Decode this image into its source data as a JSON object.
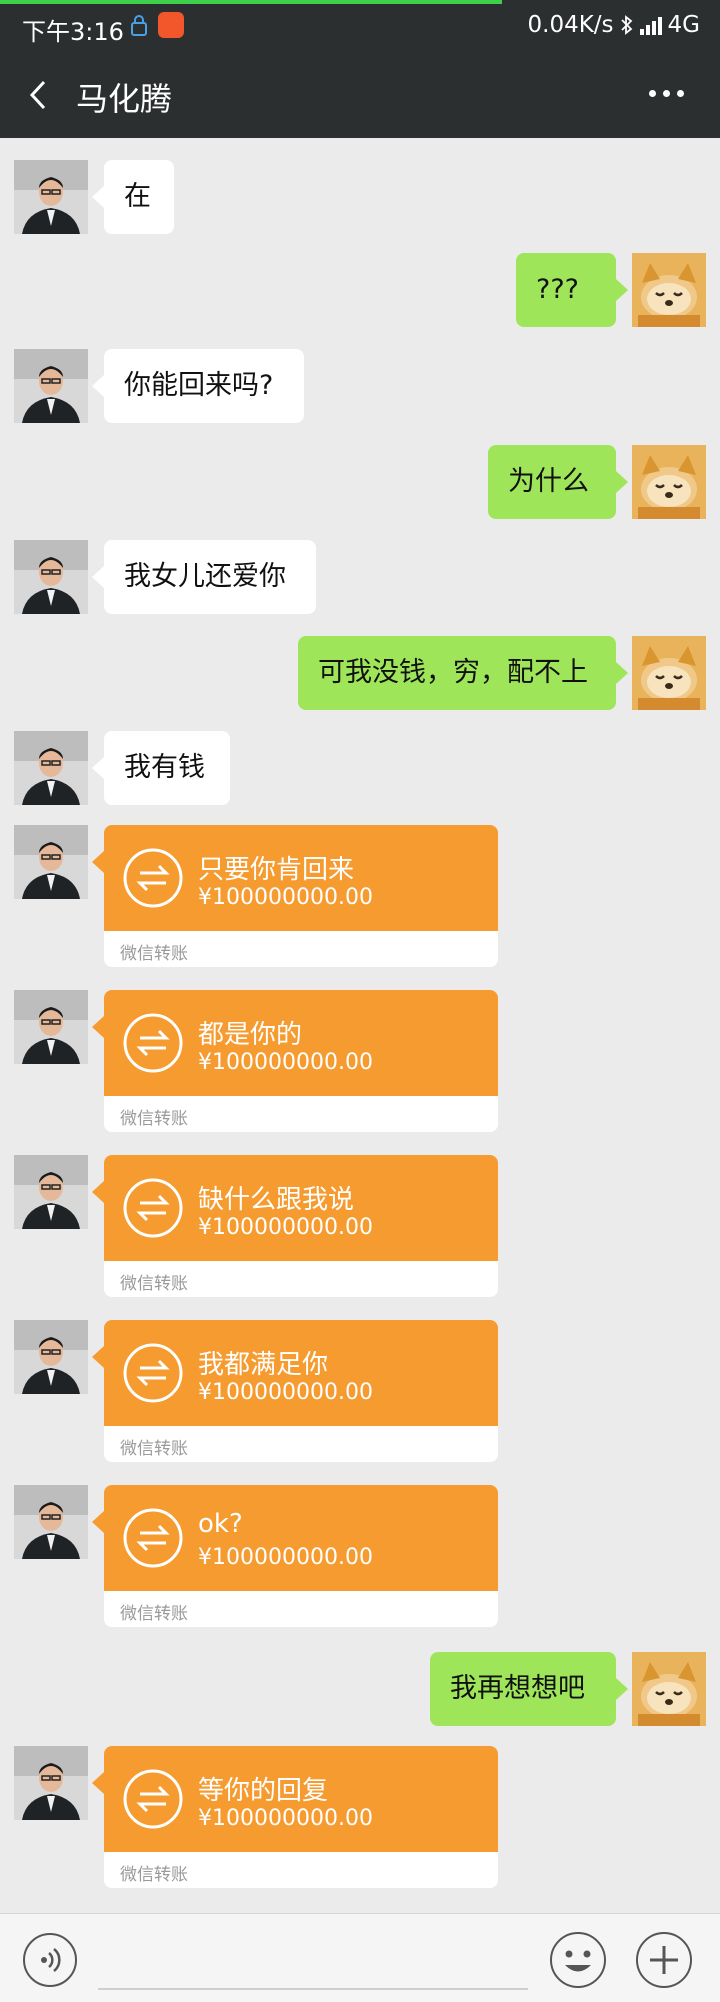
{
  "status_bar": {
    "time": "下午3:16",
    "network_speed": "0.04K/s",
    "network_type": "4G",
    "icons": [
      "lock-icon",
      "app-notification-icon",
      "bluetooth-icon",
      "signal-icon"
    ]
  },
  "header": {
    "title": "马化腾",
    "back_icon": "chevron-left-icon",
    "more_icon": "more-dots-icon",
    "background": "#2b2f30"
  },
  "colors": {
    "sent_bubble": "#9fe55a",
    "received_bubble": "#ffffff",
    "transfer_card": "#f69b30",
    "chat_background": "#ebebeb"
  },
  "messages": [
    {
      "side": "left",
      "type": "text",
      "text": "在"
    },
    {
      "side": "right",
      "type": "text",
      "text": "???"
    },
    {
      "side": "left",
      "type": "text",
      "text": "你能回来吗?"
    },
    {
      "side": "right",
      "type": "text",
      "text": "为什么"
    },
    {
      "side": "left",
      "type": "text",
      "text": "我女儿还爱你"
    },
    {
      "side": "right",
      "type": "text",
      "text": "可我没钱，穷，配不上"
    },
    {
      "side": "left",
      "type": "text",
      "text": "我有钱"
    },
    {
      "side": "left",
      "type": "transfer",
      "note": "只要你肯回来",
      "amount": "¥100000000.00",
      "label": "微信转账"
    },
    {
      "side": "left",
      "type": "transfer",
      "note": "都是你的",
      "amount": "¥100000000.00",
      "label": "微信转账"
    },
    {
      "side": "left",
      "type": "transfer",
      "note": "缺什么跟我说",
      "amount": "¥100000000.00",
      "label": "微信转账"
    },
    {
      "side": "left",
      "type": "transfer",
      "note": "我都满足你",
      "amount": "¥100000000.00",
      "label": "微信转账"
    },
    {
      "side": "left",
      "type": "transfer",
      "note": "ok?",
      "amount": "¥100000000.00",
      "label": "微信转账"
    },
    {
      "side": "right",
      "type": "text",
      "text": "我再想想吧"
    },
    {
      "side": "left",
      "type": "transfer",
      "note": "等你的回复",
      "amount": "¥100000000.00",
      "label": "微信转账"
    }
  ],
  "input_bar": {
    "voice_icon": "voice-icon",
    "emoji_icon": "emoji-icon",
    "plus_icon": "plus-icon"
  }
}
